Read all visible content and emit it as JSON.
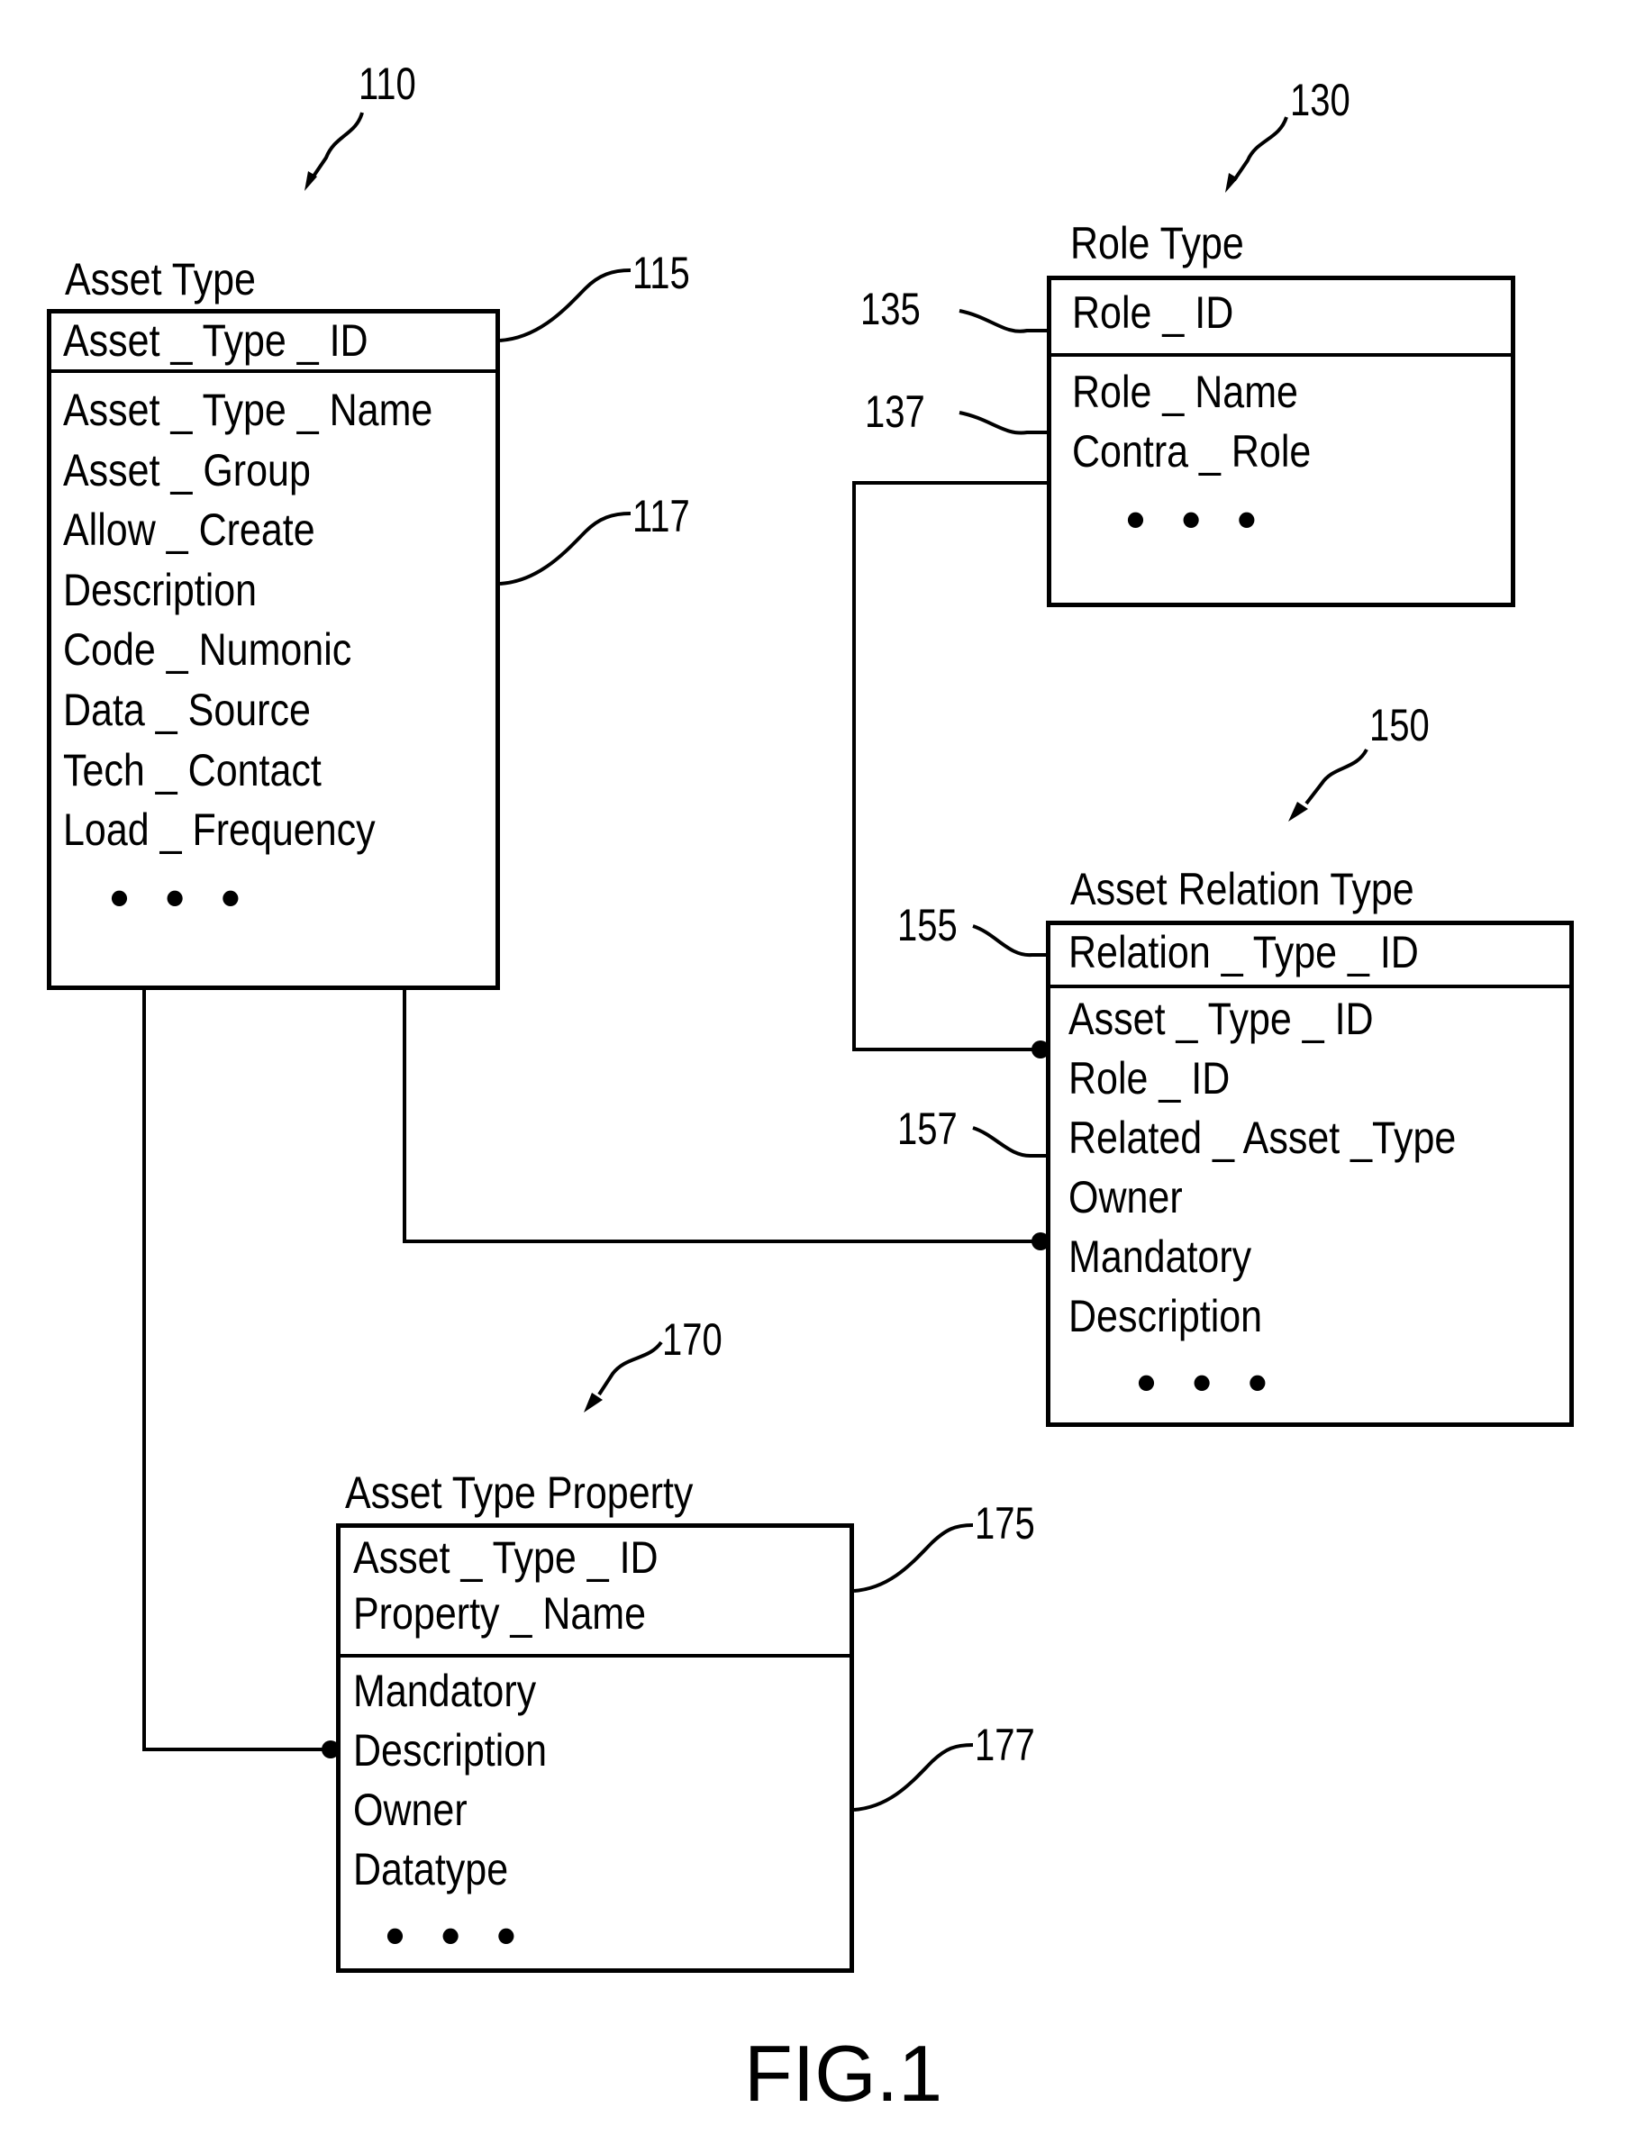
{
  "figure_label": "FIG.1",
  "entities": [
    {
      "ref": "110",
      "title": "Asset Type",
      "key_ref": "115",
      "attr_ref": "117",
      "key_fields": [
        "Asset _ Type _ ID"
      ],
      "attribute_fields": [
        "Asset _ Type _ Name",
        "Asset _ Group",
        "Allow _ Create",
        "Description",
        "Code _ Numonic",
        "Data _ Source",
        "Tech _ Contact",
        "Load _ Frequency"
      ],
      "more": "• • •"
    },
    {
      "ref": "130",
      "title": "Role  Type",
      "key_ref": "135",
      "attr_ref": "137",
      "key_fields": [
        "Role _ ID"
      ],
      "attribute_fields": [
        "Role _ Name",
        "Contra _ Role"
      ],
      "more": "• • •"
    },
    {
      "ref": "150",
      "title": "Asset  Relation  Type",
      "key_ref": "155",
      "attr_ref": "157",
      "key_fields": [
        "Relation _ Type _ ID"
      ],
      "attribute_fields": [
        "Asset _ Type _ ID",
        "Role _ ID",
        "Related _ Asset _Type",
        "Owner",
        "Mandatory",
        "Description"
      ],
      "more": "• • •"
    },
    {
      "ref": "170",
      "title": "Asset  Type  Property",
      "key_ref": "175",
      "attr_ref": "177",
      "key_fields": [
        "Asset _ Type _ ID",
        "Property _ Name"
      ],
      "attribute_fields": [
        "Mandatory",
        "Description",
        "Owner",
        "Datatype"
      ],
      "more": "• • •"
    }
  ],
  "relationships": [
    {
      "from": "Role Type",
      "to": "Asset Relation Type",
      "target_field": "Role _ ID",
      "end": "dot"
    },
    {
      "from": "Asset Type",
      "to": "Asset Relation Type",
      "target_field": "Mandatory",
      "end": "dot"
    },
    {
      "from": "Asset Type",
      "to": "Asset Type Property",
      "target_field": "Description",
      "end": "dot"
    }
  ]
}
